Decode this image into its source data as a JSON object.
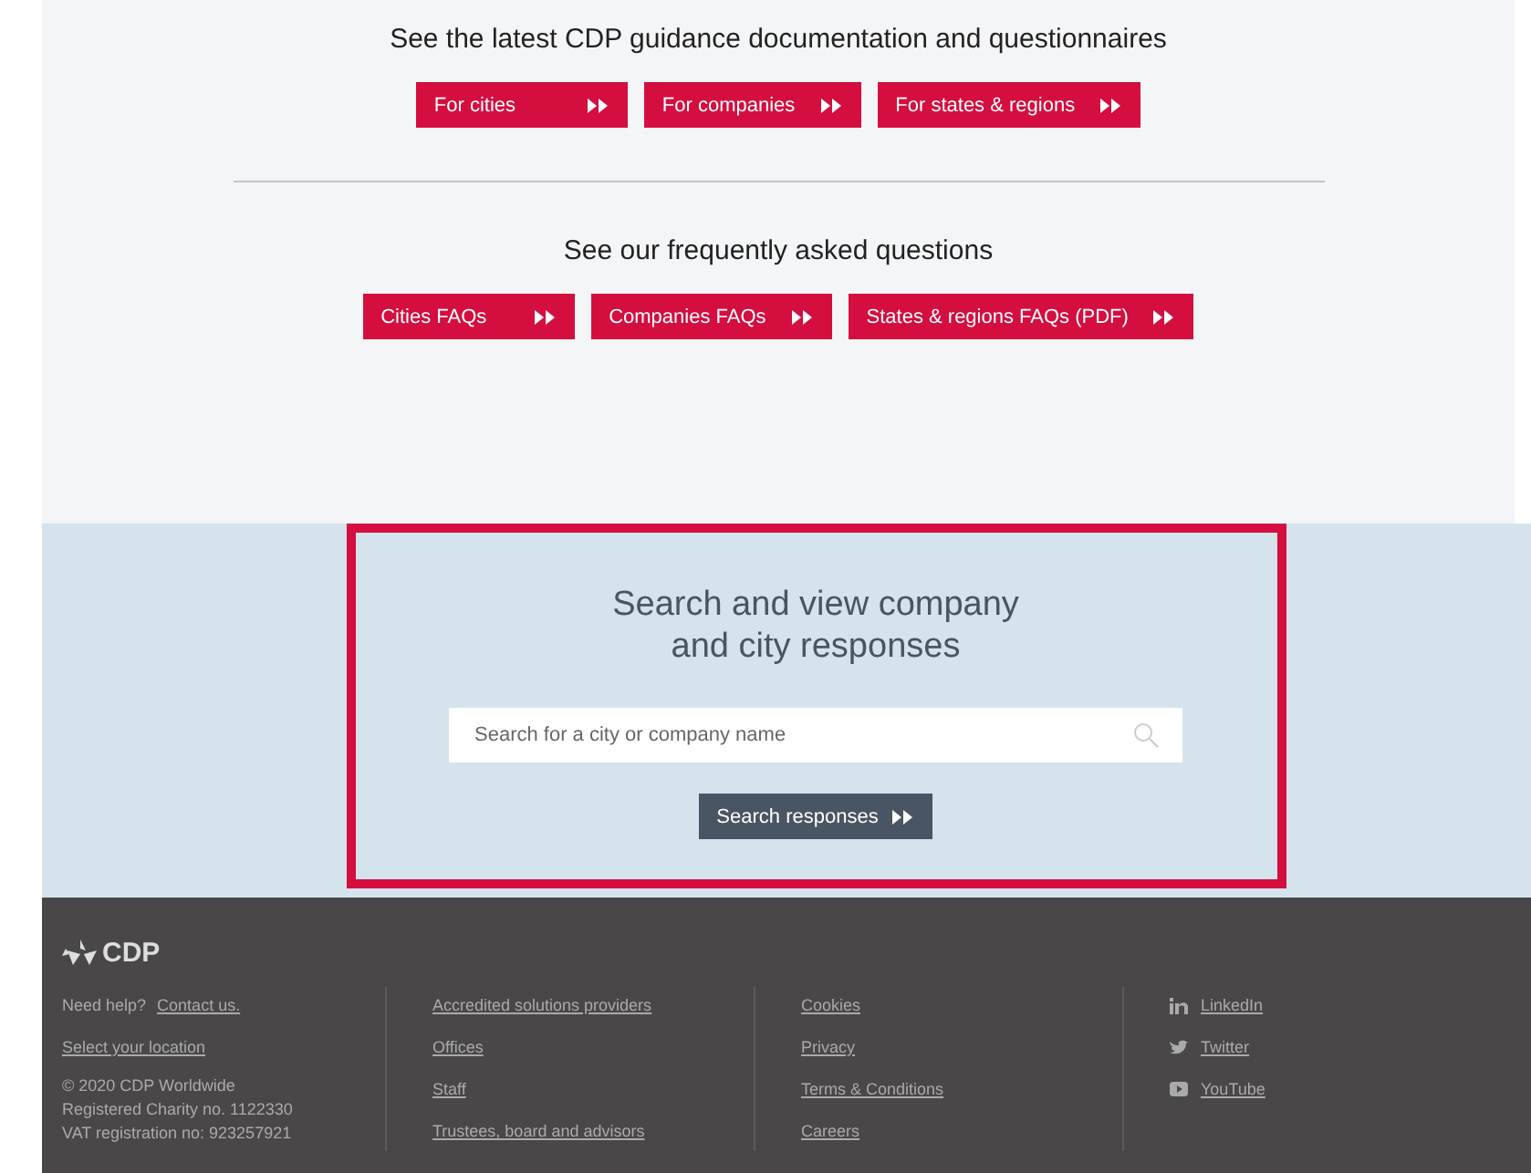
{
  "guidance": {
    "heading": "See the latest CDP guidance documentation and questionnaires",
    "buttons": [
      {
        "label": "For cities"
      },
      {
        "label": "For companies"
      },
      {
        "label": "For states & regions"
      }
    ]
  },
  "faq": {
    "heading": "See our frequently asked questions",
    "buttons": [
      {
        "label": "Cities FAQs"
      },
      {
        "label": "Companies FAQs"
      },
      {
        "label": "States & regions FAQs (PDF)"
      }
    ]
  },
  "search": {
    "title_lines": [
      "Search and view company",
      "and city responses"
    ],
    "placeholder": "Search for a city or company name",
    "button": "Search responses"
  },
  "footer": {
    "logo": "CDP",
    "help": "Need help?",
    "contact": "Contact us.",
    "location": "Select your location",
    "legal": [
      "© 2020 CDP Worldwide",
      "Registered Charity no. 1122330",
      "VAT registration no: 923257921"
    ],
    "links": [
      "Accredited solutions providers",
      "Offices",
      "Staff",
      "Trustees, board and advisors"
    ],
    "policies": [
      "Cookies",
      "Privacy",
      "Terms & Conditions",
      "Careers"
    ],
    "social": [
      {
        "kind": "linkedin",
        "label": "LinkedIn"
      },
      {
        "kind": "twitter",
        "label": "Twitter"
      },
      {
        "kind": "youtube",
        "label": "YouTube"
      }
    ]
  }
}
